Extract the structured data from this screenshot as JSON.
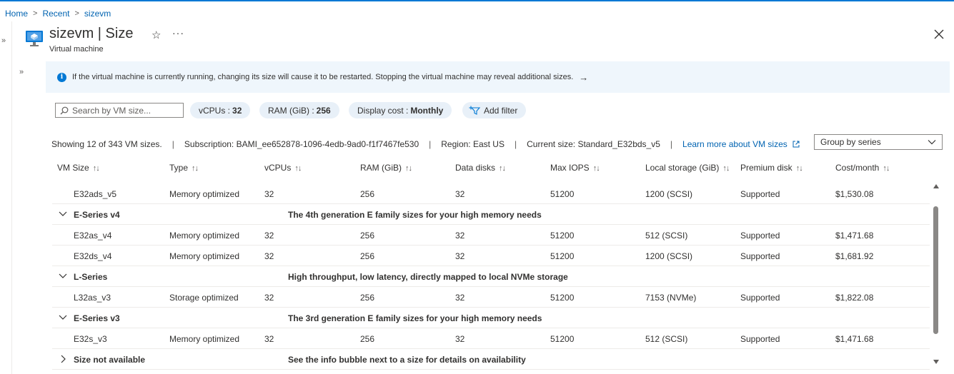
{
  "breadcrumb": {
    "home": "Home",
    "recent": "Recent",
    "current": "sizevm",
    "sep": ">"
  },
  "header": {
    "title": "sizevm | Size",
    "subtitle": "Virtual machine",
    "star": "☆",
    "more": "···"
  },
  "info": {
    "text": "If the virtual machine is currently running, changing its size will cause it to be restarted. Stopping the virtual machine may reveal additional sizes.",
    "arrow": "→"
  },
  "filters": {
    "search_placeholder": "Search by VM size...",
    "vcpus_label": "vCPUs :",
    "vcpus_value": "32",
    "ram_label": "RAM (GiB) :",
    "ram_value": "256",
    "cost_label": "Display cost :",
    "cost_value": "Monthly",
    "add_filter": "Add filter"
  },
  "summary": {
    "showing": "Showing 12 of 343 VM sizes.",
    "subscription": "Subscription: BAMI_ee652878-1096-4edb-9ad0-f1f7467fe530",
    "region": "Region: East US",
    "current_size": "Current size: Standard_E32bds_v5",
    "learn_more": "Learn more about VM sizes",
    "sep": "|"
  },
  "groupby": {
    "selected": "Group by series"
  },
  "table": {
    "sort_glyph": "↑↓",
    "headers": [
      "VM Size",
      "Type",
      "vCPUs",
      "RAM (GiB)",
      "Data disks",
      "Max IOPS",
      "Local storage (GiB)",
      "Premium disk",
      "Cost/month"
    ],
    "rows": [
      {
        "kind": "data",
        "cells": [
          "E32ads_v5",
          "Memory optimized",
          "32",
          "256",
          "32",
          "51200",
          "1200 (SCSI)",
          "Supported",
          "$1,530.08"
        ]
      },
      {
        "kind": "group",
        "name": "E-Series v4",
        "desc": "The 4th generation E family sizes for your high memory needs",
        "expanded": true
      },
      {
        "kind": "data",
        "cells": [
          "E32as_v4",
          "Memory optimized",
          "32",
          "256",
          "32",
          "51200",
          "512 (SCSI)",
          "Supported",
          "$1,471.68"
        ]
      },
      {
        "kind": "data",
        "cells": [
          "E32ds_v4",
          "Memory optimized",
          "32",
          "256",
          "32",
          "51200",
          "1200 (SCSI)",
          "Supported",
          "$1,681.92"
        ]
      },
      {
        "kind": "group",
        "name": "L-Series",
        "desc": "High throughput, low latency, directly mapped to local NVMe storage",
        "expanded": true
      },
      {
        "kind": "data",
        "cells": [
          "L32as_v3",
          "Storage optimized",
          "32",
          "256",
          "32",
          "51200",
          "7153 (NVMe)",
          "Supported",
          "$1,822.08"
        ]
      },
      {
        "kind": "group",
        "name": "E-Series v3",
        "desc": "The 3rd generation E family sizes for your high memory needs",
        "expanded": true
      },
      {
        "kind": "data",
        "cells": [
          "E32s_v3",
          "Memory optimized",
          "32",
          "256",
          "32",
          "51200",
          "512 (SCSI)",
          "Supported",
          "$1,471.68"
        ]
      },
      {
        "kind": "group",
        "name": "Size not available",
        "desc": "See the info bubble next to a size for details on availability",
        "expanded": false
      }
    ]
  }
}
